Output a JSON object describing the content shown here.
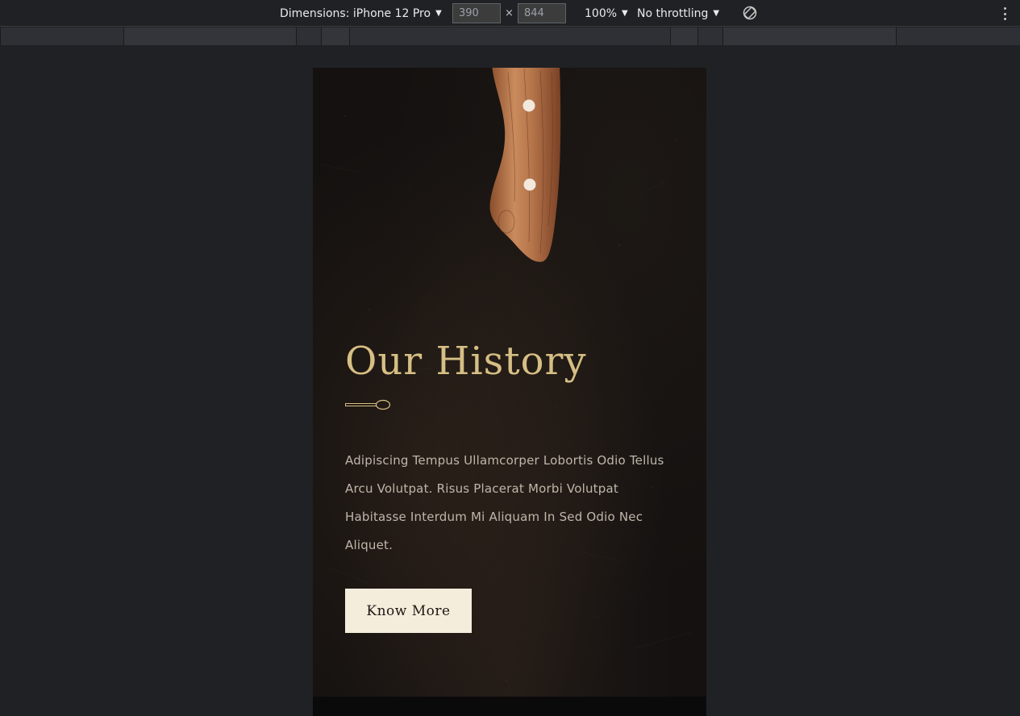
{
  "devtools": {
    "dimensions_label": "Dimensions: iPhone 12 Pro",
    "width_value": "390",
    "height_value": "844",
    "times": "×",
    "zoom": "100%",
    "throttling": "No throttling",
    "caret": "▼",
    "rotate_icon": "rotate-icon",
    "more_icon": "kebab-menu-icon"
  },
  "page": {
    "history_title": "Our History",
    "divider_icon": "spoon-icon",
    "history_body": "Adipiscing Tempus Ullamcorper Lobortis Odio Tellus Arcu Volutpat. Risus Placerat Morbi Volutpat Habitasse Interdum Mi Aliquam In Sed Odio Nec Aliquet.",
    "cta_label": "Know More",
    "hero_image": "knife-handle-image"
  },
  "colors": {
    "devtools_bg": "#202124",
    "page_bg": "#141110",
    "accent_gold": "#d6bf84",
    "body_text": "#bfb7aa",
    "button_bg": "#f5eddb",
    "knife_wood": "#b5744a"
  }
}
